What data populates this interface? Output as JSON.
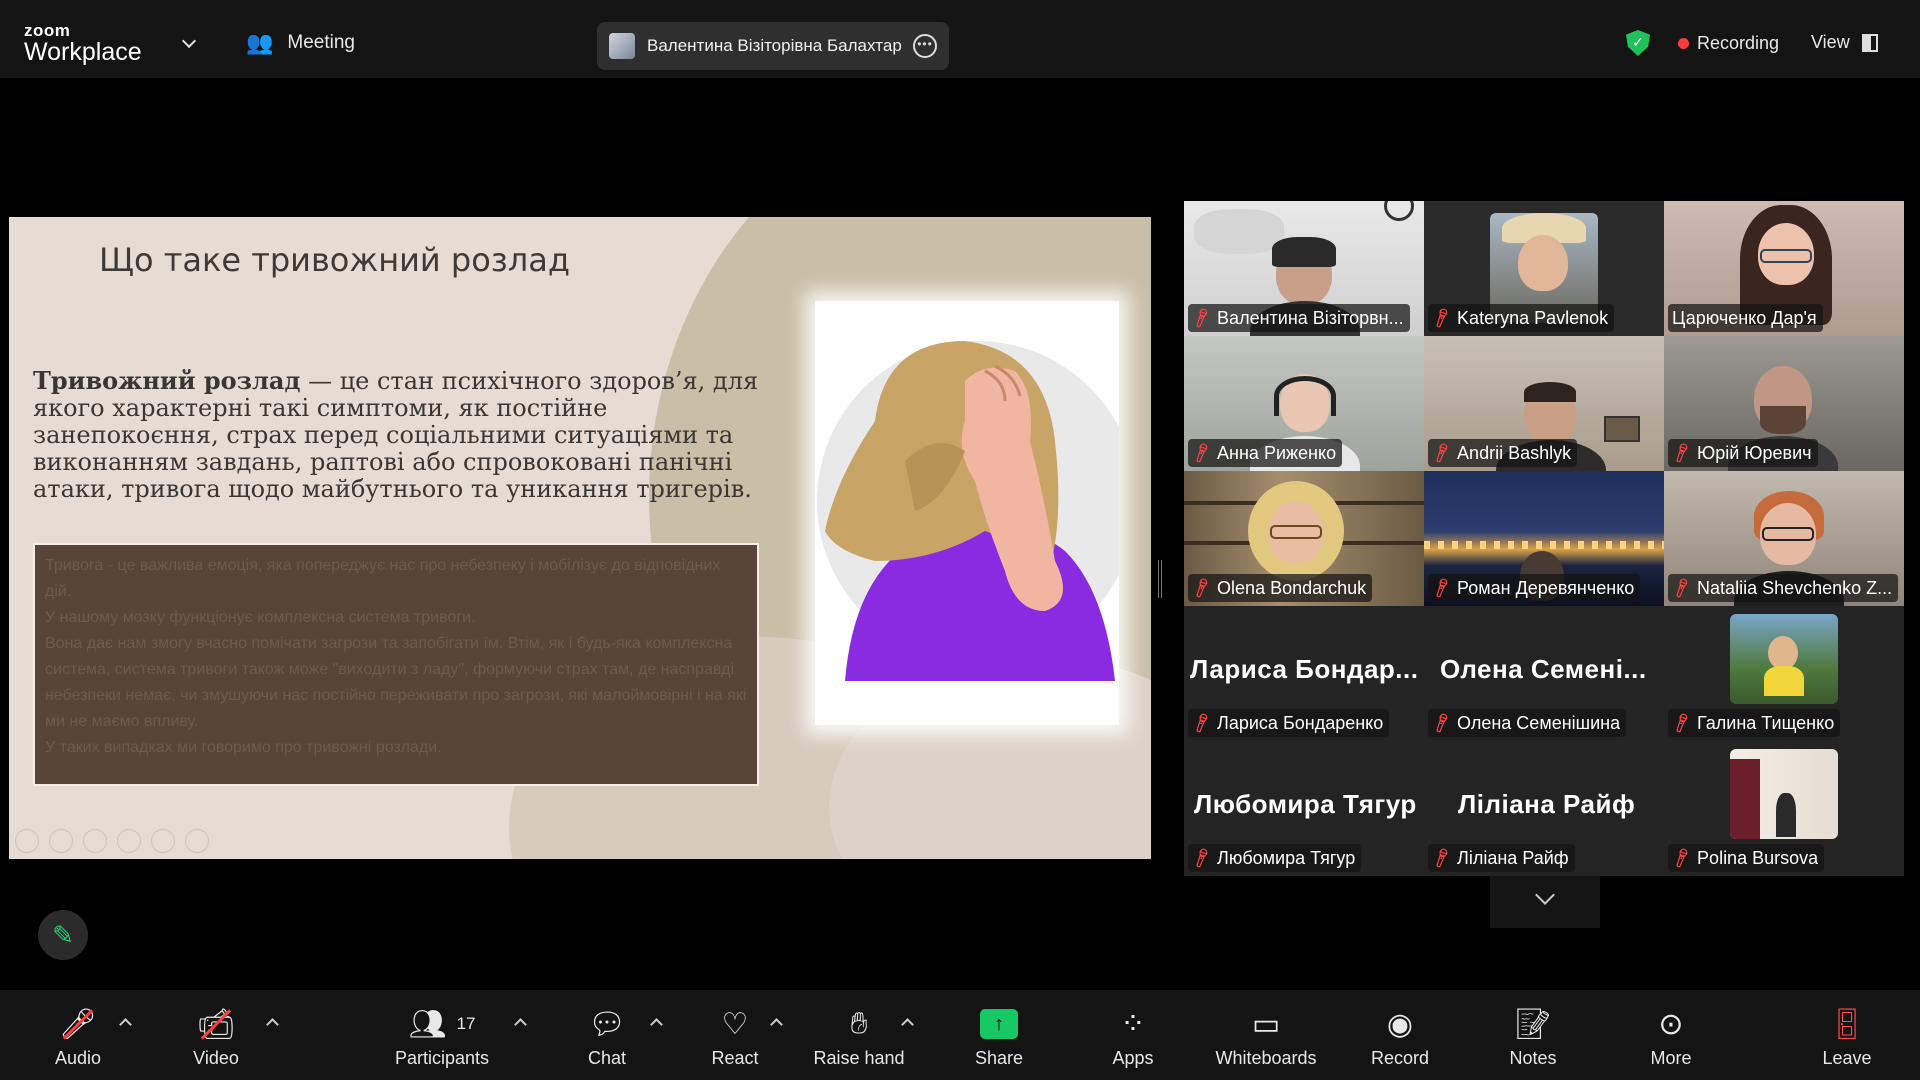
{
  "topbar": {
    "logo_small": "zoom",
    "logo_big": "Workplace",
    "meeting_label": "Meeting",
    "speaker_name": "Валентина Візіторівна Балахтар'",
    "recording_label": "Recording",
    "view_label": "View"
  },
  "slide": {
    "title": "Що таке тривожний розлад",
    "term": "Тривожний розлад",
    "definition": " — це  стан психічного здоров’я, для якого характерні такі симптоми, як постійне занепокоєння, страх перед соціальними ситуаціями та виконанням завдань, раптові або спровоковані панічні атаки, тривога щодо майбутнього та уникання тригерів.",
    "box_lines": [
      "Тривога - це важлива емоція, яка попереджує нас про небезпеку і мобілізує до відповідних дій.",
      "У нашому мозку функціонує комплексна система тривоги.",
      "Вона дає нам змогу вчасно помічати загрози та запобігати їм. Втім, як і будь-яка комплексна система, система тривоги також може \"виходити з ладу\", формуючи страх там, де насправді небезпеки немає, чи змушуючи нас постійно переживати про загрози, які малоймовірні і на які ми не маємо впливу.",
      "У таких випадках ми говоримо про тривожні розлади."
    ]
  },
  "participants": [
    {
      "name": "Валентина Візіторвн...",
      "video": true,
      "active": false
    },
    {
      "name": "Kateryna Pavlenok",
      "video": true,
      "active": false
    },
    {
      "name": "Царюченко Дар'я",
      "video": true,
      "active": true
    },
    {
      "name": "Анна Риженко",
      "video": true,
      "active": false
    },
    {
      "name": "Andrii Bashlyk",
      "video": true,
      "active": false
    },
    {
      "name": "Юрій Юревич",
      "video": true,
      "active": false
    },
    {
      "name": "Olena Bondarchuk",
      "video": true,
      "active": false
    },
    {
      "name": "Роман Деревянченко",
      "video": true,
      "active": false
    },
    {
      "name": "Nataliia Shevchenko Z...",
      "video": true,
      "active": false
    },
    {
      "name": "Лариса Бондаренко",
      "display": "Лариса  Бондар...",
      "video": false,
      "active": false
    },
    {
      "name": "Олена Семенішина",
      "display": "Олена  Семені...",
      "video": false,
      "active": false
    },
    {
      "name": "Галина Тищенко",
      "video": "thumb",
      "active": false
    },
    {
      "name": "Любомира Тягур",
      "display": "Любомира Тягур",
      "video": false,
      "active": false
    },
    {
      "name": "Ліліана Райф",
      "display": "Ліліана Райф",
      "video": false,
      "active": false
    },
    {
      "name": "Polina Bursova",
      "video": "thumb",
      "active": false
    }
  ],
  "toolbar": {
    "audio": "Audio",
    "video": "Video",
    "participants": "Participants",
    "participants_count": "17",
    "chat": "Chat",
    "react": "React",
    "raise_hand": "Raise hand",
    "share": "Share",
    "apps": "Apps",
    "whiteboards": "Whiteboards",
    "record": "Record",
    "notes": "Notes",
    "more": "More",
    "leave": "Leave"
  },
  "icons": {
    "logo_chevron": "chevron-down-icon",
    "meeting": "people-icon",
    "shield": "encryption-shield-icon",
    "annotate": "pencil-icon",
    "muted_mic": "mic-off-icon"
  },
  "colors": {
    "accent_green": "#23d35f",
    "recording_red": "#ff3b3b",
    "share_green": "#17c964",
    "slide_bg": "#e7dcd4",
    "slide_box": "#5a4339"
  }
}
